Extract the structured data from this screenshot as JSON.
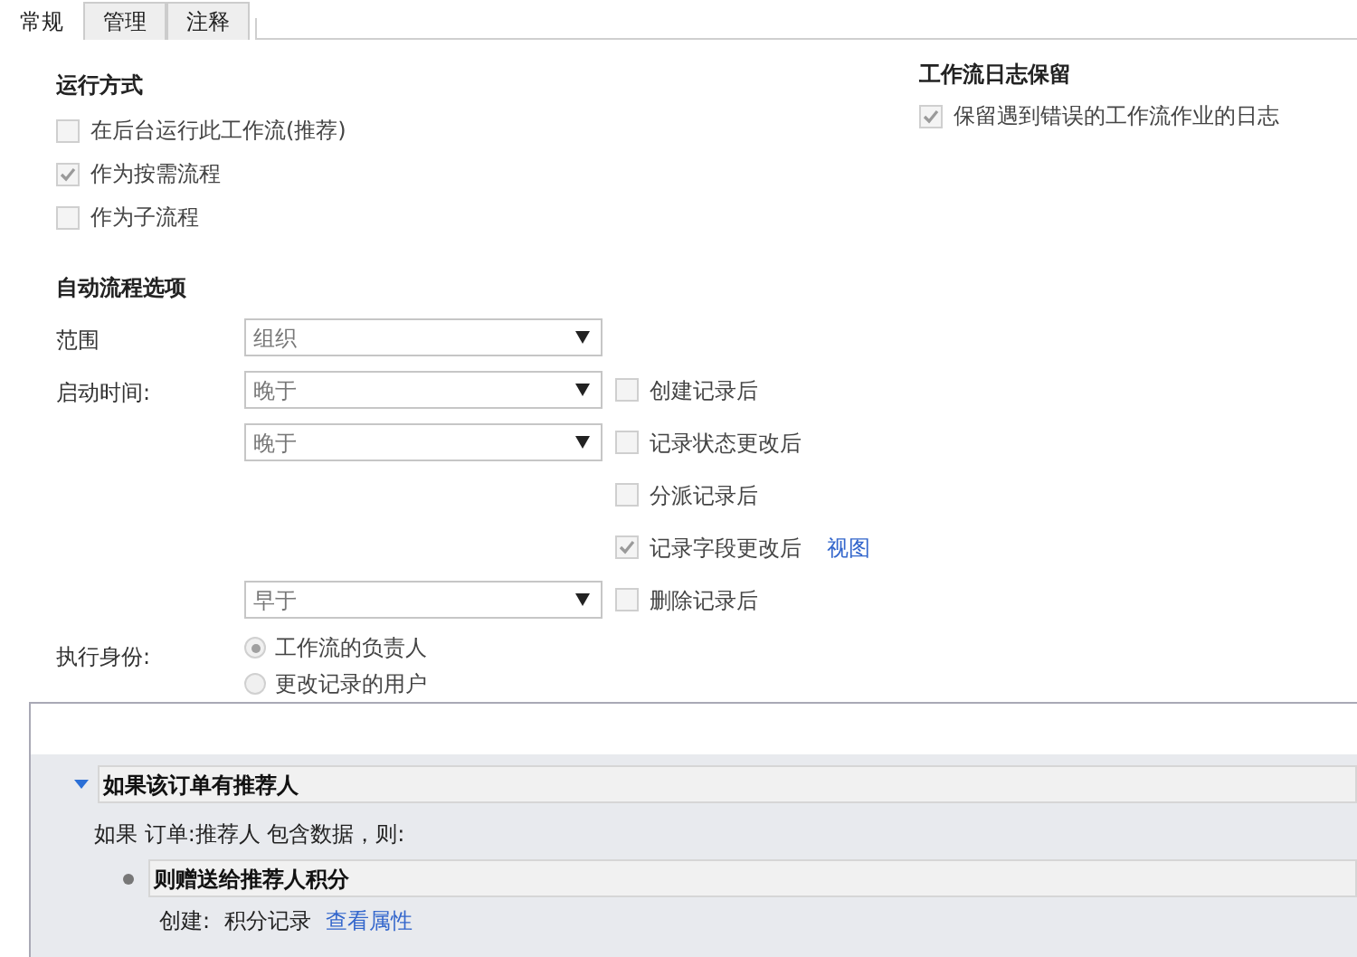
{
  "tabs": [
    {
      "label": "常规",
      "selected": true
    },
    {
      "label": "管理",
      "selected": false
    },
    {
      "label": "注释",
      "selected": false
    }
  ],
  "run_mode": {
    "heading": "运行方式",
    "options": [
      {
        "label": "在后台运行此工作流(推荐)",
        "checked": false
      },
      {
        "label": "作为按需流程",
        "checked": true
      },
      {
        "label": "作为子流程",
        "checked": false
      }
    ]
  },
  "log_retention": {
    "heading": "工作流日志保留",
    "options": [
      {
        "label": "保留遇到错误的工作流作业的日志",
        "checked": true
      }
    ]
  },
  "auto_options": {
    "heading": "自动流程选项",
    "rows": [
      {
        "label": "范围",
        "select": "组织"
      },
      {
        "label": "启动时间:",
        "select": "晚于",
        "checkbox": {
          "label": "创建记录后",
          "checked": false
        }
      },
      {
        "select": "晚于",
        "checkbox": {
          "label": "记录状态更改后",
          "checked": false
        }
      },
      {
        "checkbox": {
          "label": "分派记录后",
          "checked": false
        }
      },
      {
        "checkbox": {
          "label": "记录字段更改后",
          "checked": true
        },
        "link": "视图"
      },
      {
        "select": "早于",
        "checkbox": {
          "label": "删除记录后",
          "checked": false
        }
      }
    ]
  },
  "run_as": {
    "label": "执行身份:",
    "options": [
      {
        "label": "工作流的负责人",
        "selected": true
      },
      {
        "label": "更改记录的用户",
        "selected": false
      }
    ]
  },
  "steps": {
    "condition_title": "如果该订单有推荐人",
    "condition_text": "如果 订单:推荐人 包含数据，则:",
    "action_title": "则赠送给推荐人积分",
    "action_prefix": "创建:",
    "action_value": "积分记录",
    "action_link": "查看属性"
  }
}
